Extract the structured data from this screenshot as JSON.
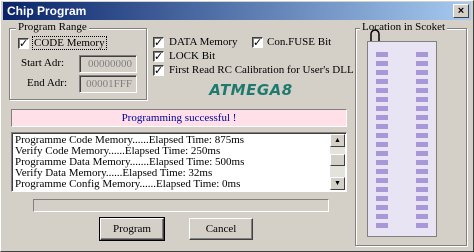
{
  "window": {
    "title": "Chip Program",
    "close_glyph": "×"
  },
  "program_range": {
    "legend": "Program Range",
    "code_memory": {
      "label": "CODE Memory",
      "checked": true
    },
    "start_label": "Start Adr:",
    "start_value": "00000000",
    "end_label": "End Adr:",
    "end_value": "00001FFF"
  },
  "options": {
    "data_memory": {
      "label": "DATA Memory",
      "checked": true
    },
    "config_fuse": {
      "label": "Con.FUSE Bit",
      "checked": true
    },
    "lock_bit": {
      "label": "LOCK Bit",
      "checked": true
    },
    "first_read_rc": {
      "label": "First Read RC Calibration for User's DLL",
      "checked": true
    }
  },
  "chip_name": "ATMEGA8",
  "status": "Programming successful !",
  "log": [
    "Programme Code Memory......Elapsed Time: 875ms",
    "Verify Code Memory......Elapsed Time: 250ms",
    "Programme Data Memory.......Elapsed Time: 500ms",
    "Verify Data Memory......Elapsed Time: 32ms",
    "Programme Config Memory......Elapsed Time: 0ms"
  ],
  "progress": 0,
  "buttons": {
    "program": "Program",
    "cancel": "Cancel"
  },
  "location": {
    "legend": "Location in Scoket"
  },
  "colors": {
    "chip_name": "#1e7a6e",
    "status_bg": "#ffe0e8",
    "status_text": "#0000a0",
    "pin": "#a898d8"
  }
}
